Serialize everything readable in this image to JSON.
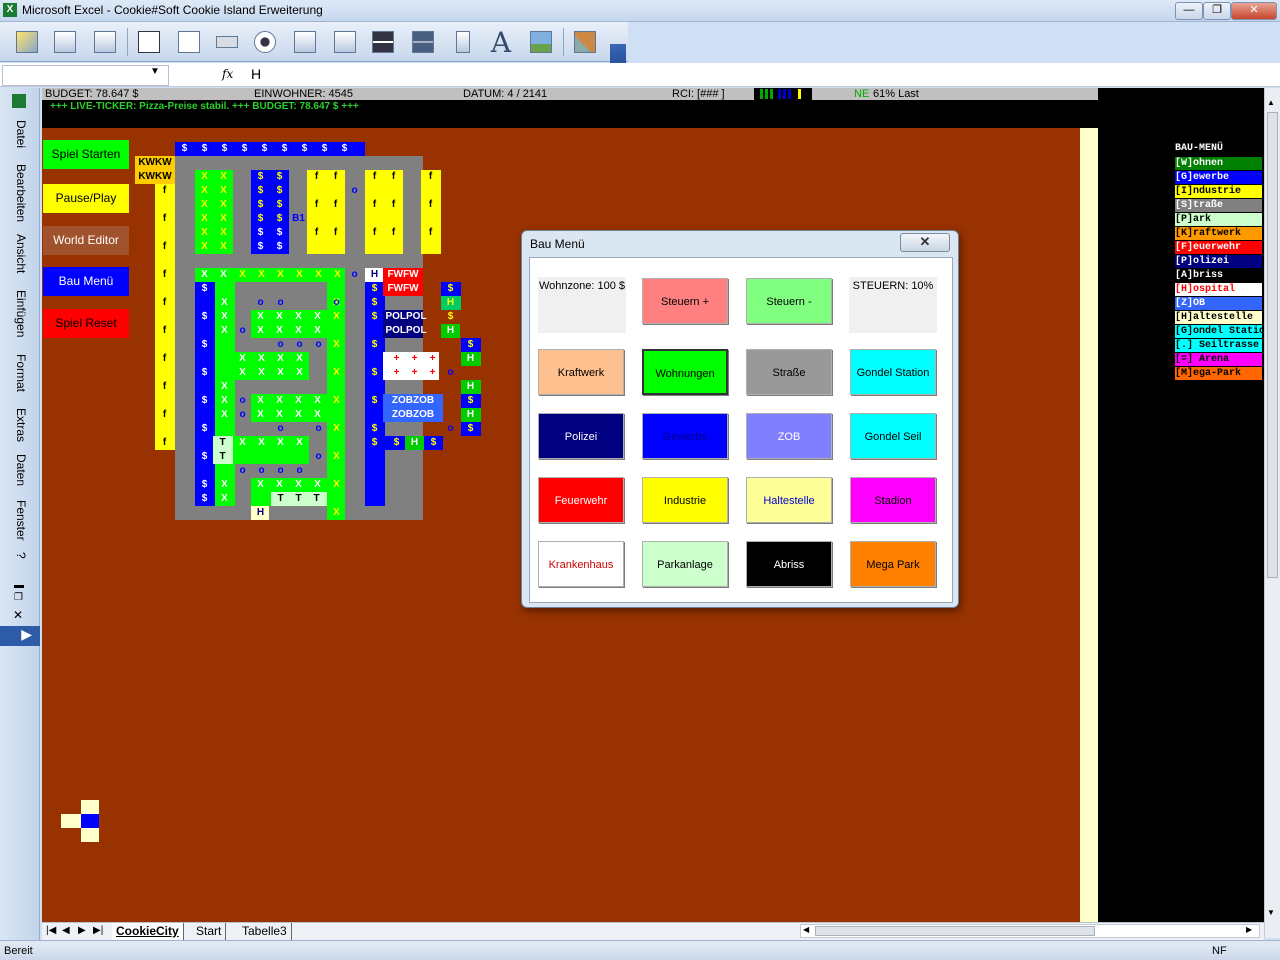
{
  "window": {
    "app_icon": "X",
    "title": "Microsoft Excel - Cookie#Soft Cookie Island Erweiterung",
    "minimize": "—",
    "restore": "❐",
    "close": "✕"
  },
  "toolbar": {
    "text_tool_label": "A",
    "dropdown_glyph": "▾"
  },
  "formula_bar": {
    "name_box": "",
    "fx": "fx",
    "value": "H"
  },
  "left_menu": [
    "Datei",
    "Bearbeiten",
    "Ansicht",
    "Einfügen",
    "Format",
    "Extras",
    "Daten",
    "Fenster",
    "?"
  ],
  "status_row": {
    "budget": "BUDGET: 78.647 $",
    "einwohner": "EINWOHNER: 4545",
    "datum": "DATUM: 4 / 2141",
    "rci": "RCI: [###   ]",
    "ne_prefix": "NE",
    "last": "61% Last"
  },
  "ticker": "+++ LIVE-TICKER: Pizza-Preise stabil. +++ BUDGET: 78.647 $ +++",
  "sheet_buttons": [
    {
      "label": "Spiel Starten",
      "bg": "#00ff00",
      "fg": "#000000"
    },
    {
      "label": "Pause/Play",
      "bg": "#ffff00",
      "fg": "#000000"
    },
    {
      "label": "World Editor",
      "bg": "#a0522d",
      "fg": "#ffffff"
    },
    {
      "label": "Bau Menü",
      "bg": "#0000ff",
      "fg": "#ffffff"
    },
    {
      "label": "Spiel Reset",
      "bg": "#ff0000",
      "fg": "#000000"
    }
  ],
  "map_labels": {
    "kwkw": "KWKW",
    "fwfw": "FWFW",
    "polpol": "POLPOL",
    "zobzob": "ZOBZOB",
    "b1": "B1",
    "hospital": "+",
    "house": "H",
    "tree": "T",
    "money": "$",
    "field": "X",
    "factory": "f",
    "stop": "o"
  },
  "bau_menu_list": {
    "title": "BAU-MENÜ",
    "items": [
      {
        "label": "[W]ohnen",
        "bg": "#008000",
        "fg": "#ffffff"
      },
      {
        "label": "[G]ewerbe",
        "bg": "#0000ff",
        "fg": "#ffffff"
      },
      {
        "label": "[I]ndustrie",
        "bg": "#ffff00",
        "fg": "#000000"
      },
      {
        "label": "[S]traße",
        "bg": "#808080",
        "fg": "#ffffff"
      },
      {
        "label": "[P]ark",
        "bg": "#ccffcc",
        "fg": "#000000"
      },
      {
        "label": "[K]raftwerk",
        "bg": "#ff9900",
        "fg": "#000000"
      },
      {
        "label": "[F]euerwehr",
        "bg": "#ff0000",
        "fg": "#ffffff"
      },
      {
        "label": "[P]olizei",
        "bg": "#000080",
        "fg": "#ffffff"
      },
      {
        "label": "[A]briss",
        "bg": "#000000",
        "fg": "#ffffff"
      },
      {
        "label": "[H]ospital",
        "bg": "#ffffff",
        "fg": "#ff0000"
      },
      {
        "label": "[Z]OB",
        "bg": "#3366ff",
        "fg": "#ffffff"
      },
      {
        "label": "[H]altestelle",
        "bg": "#ffffcc",
        "fg": "#000000"
      },
      {
        "label": "[G]ondel Station",
        "bg": "#00ffff",
        "fg": "#000000"
      },
      {
        "label": "[.] Seiltrasse",
        "bg": "#00ffff",
        "fg": "#000000"
      },
      {
        "label": "[=] Arena",
        "bg": "#ff00ff",
        "fg": "#000000"
      },
      {
        "label": "[M]ega-Park",
        "bg": "#ff6600",
        "fg": "#000000"
      }
    ]
  },
  "dialog": {
    "title": "Bau Menü",
    "close": "✕",
    "wohnzone_label": "Wohnzone: 100 $",
    "steuern_label": "STEUERN: 10%",
    "steuern_plus": "Steuern +",
    "steuern_minus": "Steuern -",
    "buttons": [
      {
        "label": "Kraftwerk",
        "bg": "#ffc090",
        "fg": "#000000"
      },
      {
        "label": "Wohnungen",
        "bg": "#00ff00",
        "fg": "#000000"
      },
      {
        "label": "Straße",
        "bg": "#999999",
        "fg": "#000000"
      },
      {
        "label": "Gondel Station",
        "bg": "#00ffff",
        "fg": "#000000"
      },
      {
        "label": "Polizei",
        "bg": "#000080",
        "fg": "#ffffff"
      },
      {
        "label": "Gewerbe",
        "bg": "#0000ff",
        "fg": "#00008b"
      },
      {
        "label": "ZOB",
        "bg": "#8080ff",
        "fg": "#ffffff"
      },
      {
        "label": "Gondel Seil",
        "bg": "#00ffff",
        "fg": "#000000"
      },
      {
        "label": "Feuerwehr",
        "bg": "#ff0000",
        "fg": "#ffffff"
      },
      {
        "label": "Industrie",
        "bg": "#ffff00",
        "fg": "#000000"
      },
      {
        "label": "Haltestelle",
        "bg": "#ffff99",
        "fg": "#0000cc"
      },
      {
        "label": "Stadion",
        "bg": "#ff00ff",
        "fg": "#000000"
      },
      {
        "label": "Krankenhaus",
        "bg": "#ffffff",
        "fg": "#cc0000"
      },
      {
        "label": "Parkanlage",
        "bg": "#ccffcc",
        "fg": "#000000"
      },
      {
        "label": "Abriss",
        "bg": "#000000",
        "fg": "#ffffff"
      },
      {
        "label": "Mega Park",
        "bg": "#ff8000",
        "fg": "#000000"
      }
    ]
  },
  "sheet_tabs": [
    "CookieCity",
    "Start",
    "Tabelle3"
  ],
  "status_bar": {
    "left": "Bereit",
    "right": "NF"
  }
}
